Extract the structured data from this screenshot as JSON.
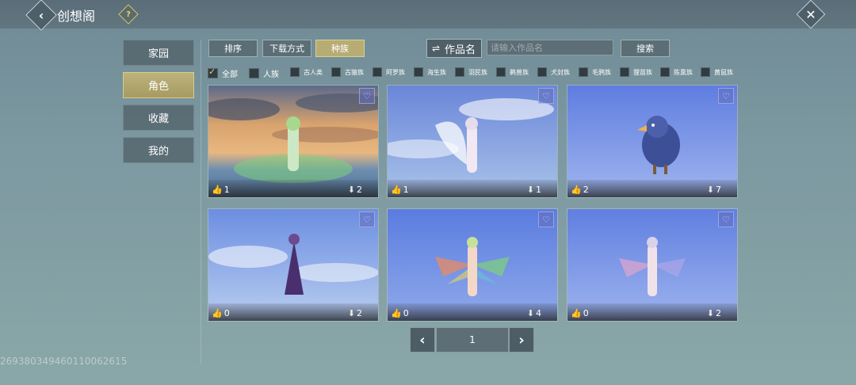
{
  "header": {
    "title": "创想阁",
    "back_icon": "‹",
    "help_icon": "?",
    "close_icon": "✕"
  },
  "nav": {
    "items": [
      {
        "label": "家园",
        "active": false
      },
      {
        "label": "角色",
        "active": true
      },
      {
        "label": "收藏",
        "active": false
      },
      {
        "label": "我的",
        "active": false
      }
    ]
  },
  "toolbar": {
    "sort_label": "排序",
    "download_label": "下载方式",
    "race_label": "种族",
    "works_label": "作品名",
    "search_placeholder": "请输入作品名",
    "search_button": "搜索"
  },
  "filters": [
    {
      "label": "全部",
      "checked": true
    },
    {
      "label": "人族",
      "checked": false
    },
    {
      "label": "古人类",
      "checked": false
    },
    {
      "label": "古猿族",
      "checked": false
    },
    {
      "label": "阿罗族",
      "checked": false
    },
    {
      "label": "海生族",
      "checked": false
    },
    {
      "label": "羽民族",
      "checked": false
    },
    {
      "label": "鹈兽族",
      "checked": false
    },
    {
      "label": "犬封族",
      "checked": false
    },
    {
      "label": "毛鸦族",
      "checked": false
    },
    {
      "label": "狸苗族",
      "checked": false
    },
    {
      "label": "陈熏族",
      "checked": false
    },
    {
      "label": "黄鼠族",
      "checked": false
    }
  ],
  "works": [
    {
      "likes": "1",
      "downloads": "2",
      "scene": "sunset-fairy-green"
    },
    {
      "likes": "1",
      "downloads": "1",
      "scene": "winged-angel-white"
    },
    {
      "likes": "2",
      "downloads": "7",
      "scene": "blue-bird-creature"
    },
    {
      "likes": "0",
      "downloads": "2",
      "scene": "purple-dress-figure"
    },
    {
      "likes": "0",
      "downloads": "4",
      "scene": "rainbow-fairy"
    },
    {
      "likes": "0",
      "downloads": "2",
      "scene": "pastel-fairy"
    }
  ],
  "icons": {
    "like": "like-icon",
    "download": "download-icon",
    "favorite": "heart-icon"
  },
  "pager": {
    "current_page": "1",
    "prev_icon": "‹",
    "next_icon": "›"
  },
  "uid": "269380349460110062615",
  "colors": {
    "accent": "#b7ad74",
    "check": "#e7d45f"
  }
}
